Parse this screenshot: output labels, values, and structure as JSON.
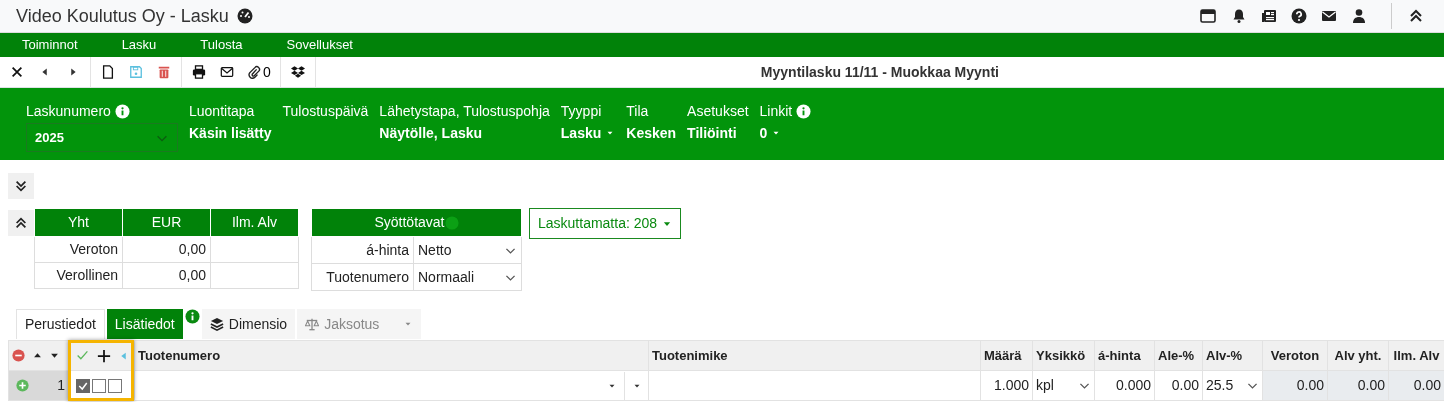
{
  "window": {
    "title": "Video Koulutus Oy - Lasku"
  },
  "menu": [
    {
      "label": "Toiminnot"
    },
    {
      "label": "Lasku"
    },
    {
      "label": "Tulosta"
    },
    {
      "label": "Sovellukset"
    }
  ],
  "toolbar": {
    "attachments_count": "0",
    "title": "Myyntilasku 11/11 - Muokkaa Myynti"
  },
  "header_fields": [
    {
      "label": "Laskunumero",
      "kind": "select",
      "value": "2025",
      "info": true
    },
    {
      "label": "Luontitapa",
      "kind": "text",
      "value": "Käsin lisätty"
    },
    {
      "label": "Tulostuspäivä",
      "kind": "text"
    },
    {
      "label": "Lähetystapa, Tulostuspohja",
      "kind": "text",
      "value": "Näytölle, Lasku"
    },
    {
      "label": "Tyyppi",
      "kind": "dropdown",
      "value": "Lasku"
    },
    {
      "label": "Tila",
      "kind": "text",
      "value": "Kesken"
    },
    {
      "label": "Asetukset",
      "kind": "text",
      "value": "Tiliöinti"
    },
    {
      "label": "Linkit",
      "kind": "dropdown",
      "value": "0",
      "info": true
    }
  ],
  "totals": {
    "columns": [
      "Yht",
      "EUR",
      "Ilm. Alv"
    ],
    "rows": [
      {
        "label": "Veroton",
        "value": "0,00"
      },
      {
        "label": "Verollinen",
        "value": "0,00"
      }
    ]
  },
  "input_modes": {
    "title": "Syöttötavat",
    "info": true,
    "rows": [
      {
        "label": "á-hinta",
        "value": "Netto"
      },
      {
        "label": "Tuotenumero",
        "value": "Normaali"
      }
    ]
  },
  "unbilled_button": "Laskuttamatta: 208",
  "tabs": [
    {
      "label": "Perustiedot",
      "kind": "text",
      "selected": false,
      "disabled": false
    },
    {
      "label": "Lisätiedot",
      "kind": "text",
      "selected": true,
      "disabled": false,
      "info": true
    },
    {
      "label": "Dimensio",
      "kind": "layers",
      "selected": false,
      "disabled": false
    },
    {
      "label": "Jaksotus",
      "kind": "balance",
      "selected": false,
      "disabled": true,
      "dropdown": true
    }
  ],
  "grid": {
    "columns": [
      {
        "label": "Tuotenumero",
        "kind": "lookup"
      },
      {
        "label": "Tuotenimike",
        "kind": "text"
      },
      {
        "label": "Määrä",
        "kind": "number"
      },
      {
        "label": "Yksikkö",
        "kind": "select"
      },
      {
        "label": "á-hinta",
        "kind": "number"
      },
      {
        "label": "Ale-%",
        "kind": "number"
      },
      {
        "label": "Alv-%",
        "kind": "select"
      },
      {
        "label": "Veroton",
        "kind": "computed"
      },
      {
        "label": "Alv yht.",
        "kind": "computed"
      },
      {
        "label": "Ilm. Alv",
        "kind": "computed"
      }
    ],
    "rows": [
      {
        "number": "1",
        "checks": [
          {
            "checked": true
          },
          {
            "checked": false
          },
          {
            "checked": false
          }
        ],
        "cells": [
          {},
          {},
          {
            "value": "1.000"
          },
          {
            "value": "kpl"
          },
          {
            "value": "0.000"
          },
          {
            "value": "0.00"
          },
          {
            "value": "25.5"
          },
          {
            "value": "0.00"
          },
          {
            "value": "0.00"
          },
          {
            "value": "0.00"
          }
        ]
      }
    ]
  }
}
